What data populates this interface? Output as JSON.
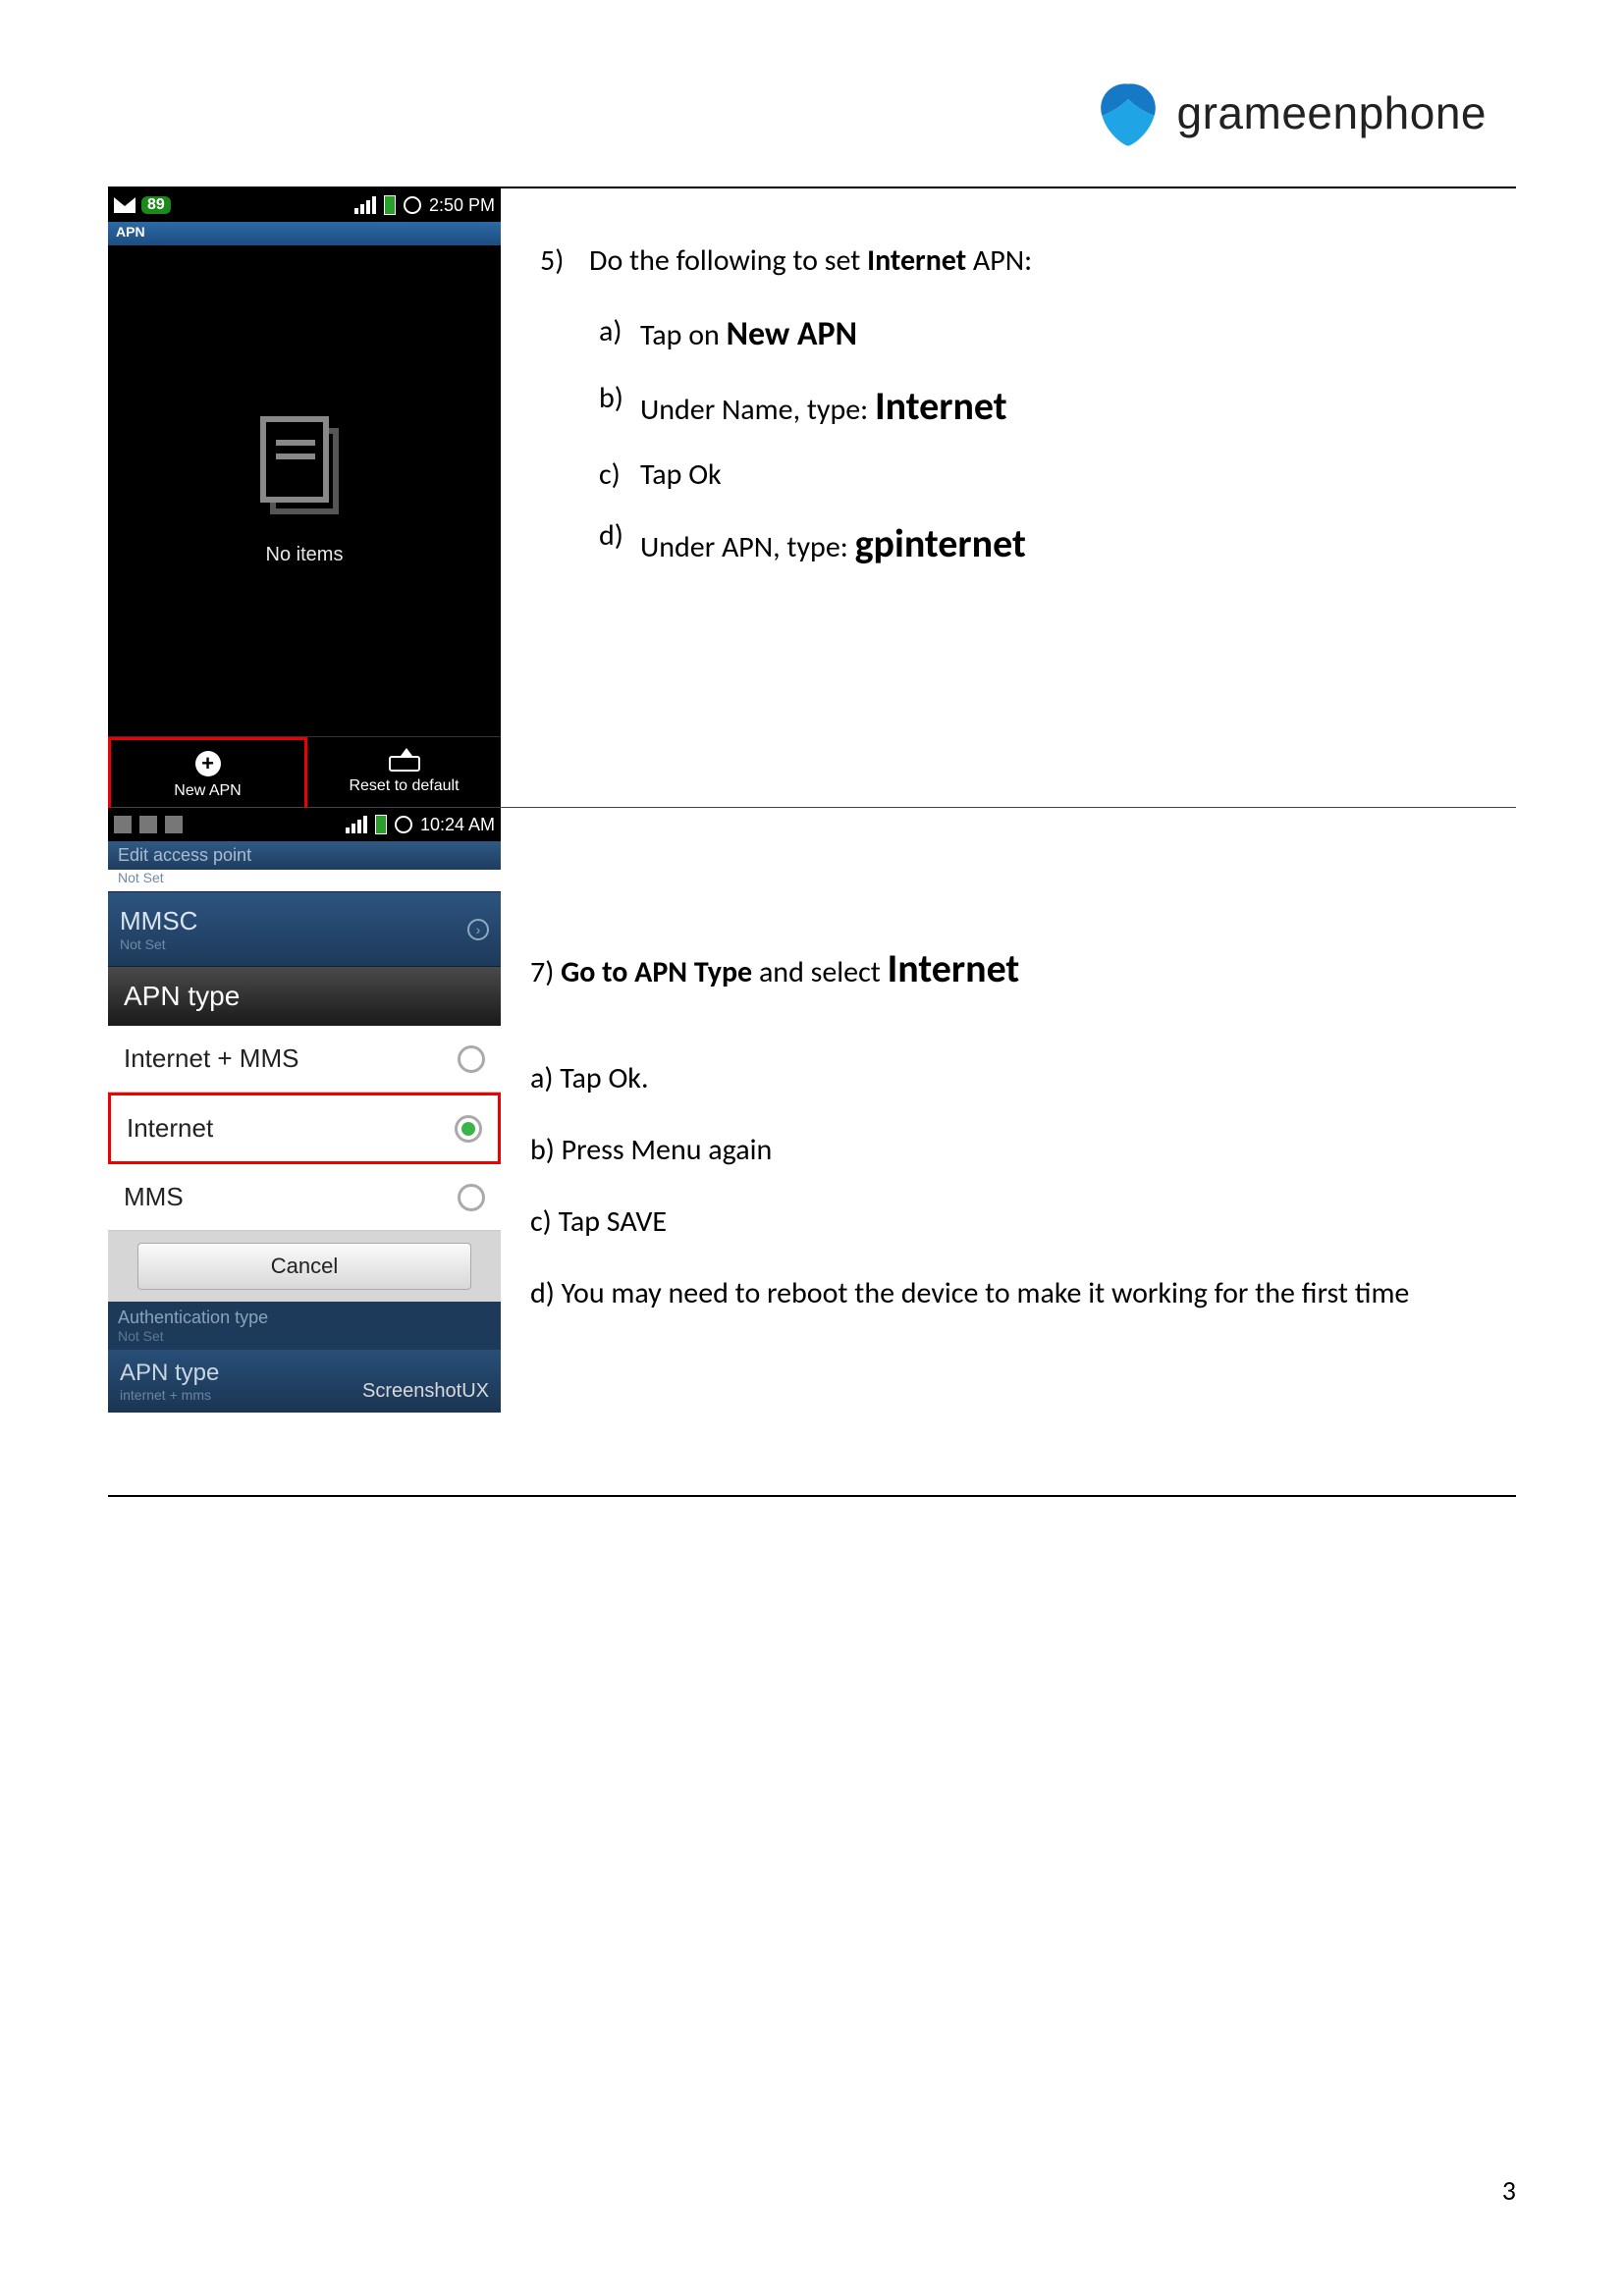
{
  "logo_text": "grameenphone",
  "page_number": "3",
  "phone1": {
    "status_badge": "89",
    "status_time": "2:50 PM",
    "apn_tab": "APN",
    "no_items": "No items",
    "new_apn": "New APN",
    "reset": "Reset to default"
  },
  "phone2": {
    "status_time": "10:24 AM",
    "header_title": "Edit access point",
    "header_sub": "Not Set",
    "mmsc_label": "MMSC",
    "mmsc_sub": "Not Set",
    "dialog_title": "APN type",
    "opt_internet_mms": "Internet + MMS",
    "opt_internet": "Internet",
    "opt_mms": "MMS",
    "cancel": "Cancel",
    "auth_label": "Authentication type",
    "auth_sub": "Not Set",
    "apn_type_label": "APN type",
    "apn_type_sub": "internet + mms",
    "watermark": "ScreenshotUX"
  },
  "section5": {
    "num": "5)",
    "lead": "Do the following to set ",
    "lead_bold": "Internet",
    "lead_tail": " APN:",
    "a_let": "a)",
    "a_text": "Tap on ",
    "a_bold": "New APN",
    "b_let": "b)",
    "b_text": "Under Name, type: ",
    "b_bold": "Internet",
    "c_let": "c)",
    "c_text": " Tap Ok",
    "d_let": "d)",
    "d_text": "Under APN, type: ",
    "d_bold": "gpinternet"
  },
  "section7": {
    "num": "7) ",
    "lead_bold": "Go to APN Type",
    "lead_mid": " and select ",
    "lead_big": "Internet",
    "a": "a) Tap Ok.",
    "b": "b) Press Menu again",
    "c": "c) Tap SAVE",
    "d": "d) You may need to reboot the device to make it working for the first time"
  }
}
